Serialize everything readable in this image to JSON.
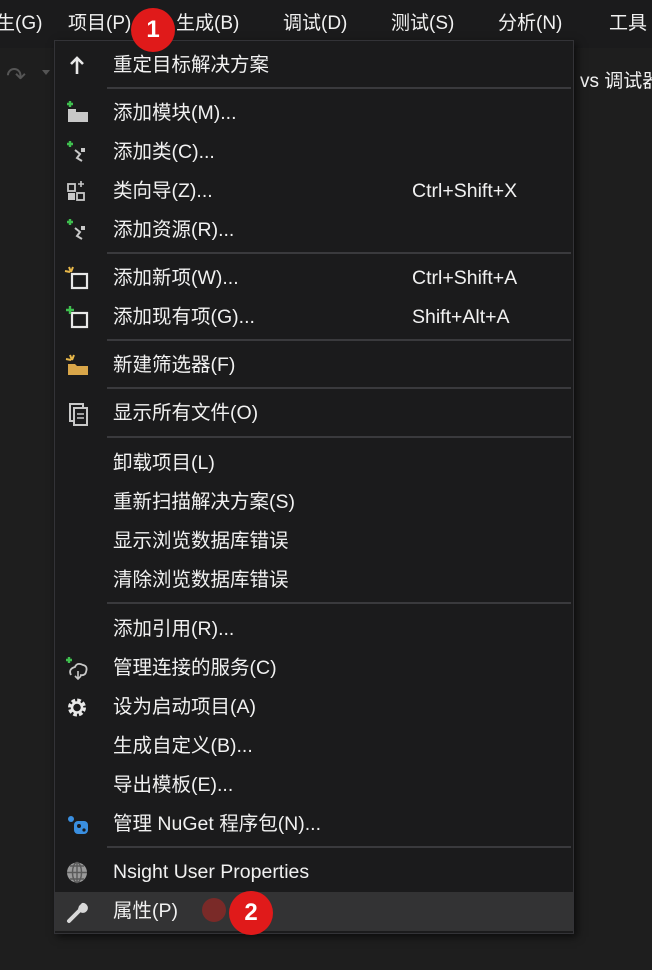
{
  "menubar": {
    "items": [
      "生(G)",
      "项目(P)",
      "生成(B)",
      "调试(D)",
      "测试(S)",
      "分析(N)",
      "工具"
    ]
  },
  "toolbar": {
    "right_text": "vs 调试器"
  },
  "menu": {
    "items": [
      {
        "label": "重定目标解决方案",
        "shortcut": "",
        "icon": "arrow-up-icon"
      },
      {
        "label": "添加模块(M)...",
        "shortcut": "",
        "icon": "add-module-icon"
      },
      {
        "label": "添加类(C)...",
        "shortcut": "",
        "icon": "add-class-icon"
      },
      {
        "label": "类向导(Z)...",
        "shortcut": "Ctrl+Shift+X",
        "icon": "class-wizard-icon"
      },
      {
        "label": "添加资源(R)...",
        "shortcut": "",
        "icon": "add-resource-icon"
      },
      {
        "label": "添加新项(W)...",
        "shortcut": "Ctrl+Shift+A",
        "icon": "add-new-item-icon"
      },
      {
        "label": "添加现有项(G)...",
        "shortcut": "Shift+Alt+A",
        "icon": "add-existing-item-icon"
      },
      {
        "label": "新建筛选器(F)",
        "shortcut": "",
        "icon": "new-filter-folder-icon"
      },
      {
        "label": "显示所有文件(O)",
        "shortcut": "",
        "icon": "show-all-files-icon"
      },
      {
        "label": "卸载项目(L)",
        "shortcut": "",
        "icon": ""
      },
      {
        "label": "重新扫描解决方案(S)",
        "shortcut": "",
        "icon": ""
      },
      {
        "label": "显示浏览数据库错误",
        "shortcut": "",
        "icon": ""
      },
      {
        "label": "清除浏览数据库错误",
        "shortcut": "",
        "icon": ""
      },
      {
        "label": "添加引用(R)...",
        "shortcut": "",
        "icon": ""
      },
      {
        "label": "管理连接的服务(C)",
        "shortcut": "",
        "icon": "connected-services-icon"
      },
      {
        "label": "设为启动项目(A)",
        "shortcut": "",
        "icon": "gear-icon"
      },
      {
        "label": "生成自定义(B)...",
        "shortcut": "",
        "icon": ""
      },
      {
        "label": "导出模板(E)...",
        "shortcut": "",
        "icon": ""
      },
      {
        "label": "管理 NuGet 程序包(N)...",
        "shortcut": "",
        "icon": "nuget-icon"
      },
      {
        "label": "Nsight User Properties",
        "shortcut": "",
        "icon": "nsight-globe-icon"
      },
      {
        "label": "属性(P)",
        "shortcut": "",
        "icon": "wrench-icon"
      }
    ]
  },
  "badges": {
    "step1": "1",
    "step2": "2"
  },
  "colors": {
    "menu_bg": "#1b1b1c",
    "hover_bg": "#333334",
    "badge": "#e01a1a",
    "text": "#f1f1f1"
  }
}
